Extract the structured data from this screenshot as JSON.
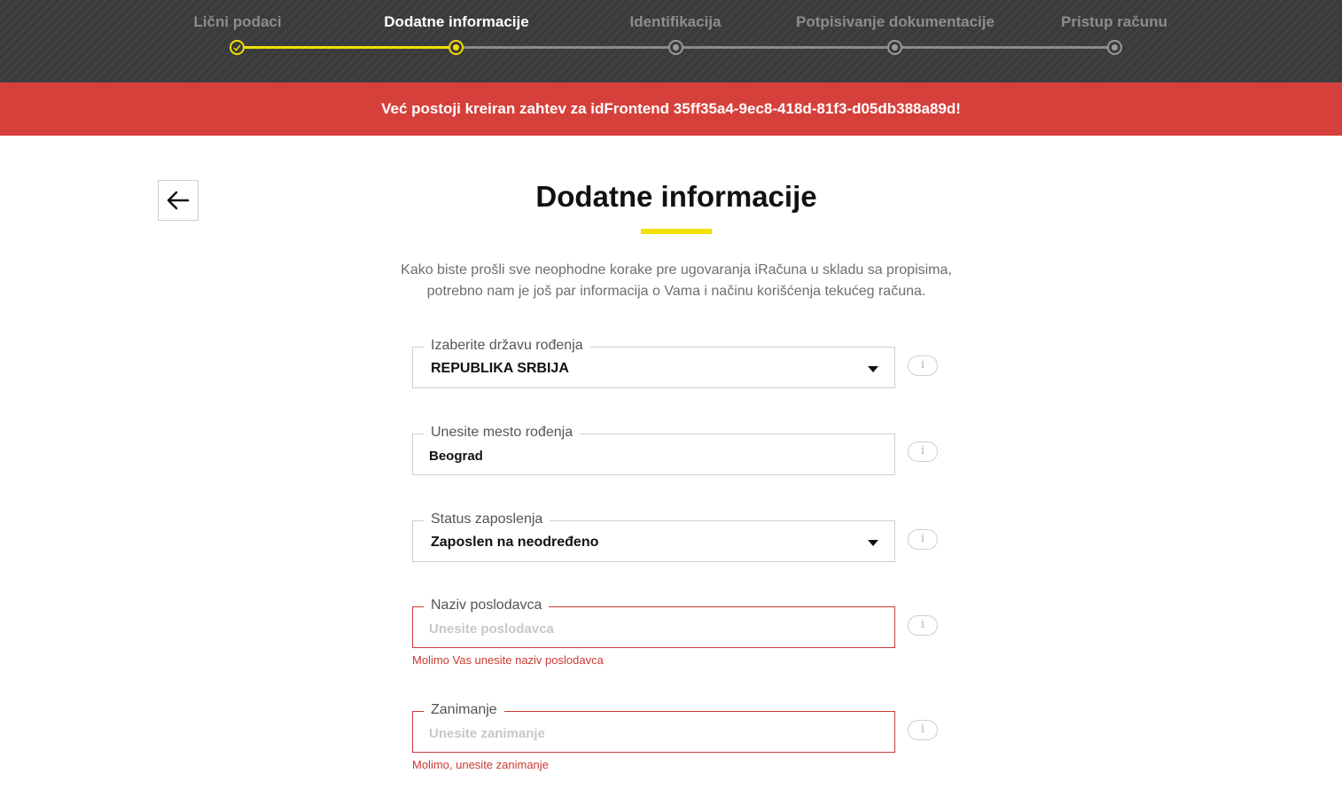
{
  "stepper": {
    "steps": [
      {
        "label": "Lični podaci",
        "state": "done"
      },
      {
        "label": "Dodatne informacije",
        "state": "active"
      },
      {
        "label": "Identifikacija",
        "state": "pending"
      },
      {
        "label": "Potpisivanje dokumentacije",
        "state": "pending"
      },
      {
        "label": "Pristup računu",
        "state": "pending"
      }
    ]
  },
  "banner": {
    "message": "Već postoji kreiran zahtev za idFrontend 35ff35a4-9ec8-418d-81f3-d05db388a89d!"
  },
  "back_button": {
    "icon": "arrow-left-icon"
  },
  "page": {
    "title": "Dodatne informacije",
    "intro_line1": "Kako biste prošli sve neophodne korake pre ugovaranja iRačuna u skladu sa propisima,",
    "intro_line2": "potrebno nam je još par informacija o Vama i načinu korišćenja tekućeg računa."
  },
  "form": {
    "country": {
      "label": "Izaberite državu rođenja",
      "value": "REPUBLIKA SRBIJA"
    },
    "birthplace": {
      "label": "Unesite mesto rođenja",
      "value": "Beograd"
    },
    "employment": {
      "label": "Status zaposlenja",
      "value": "Zaposlen na neodređeno"
    },
    "employer": {
      "label": "Naziv poslodavca",
      "placeholder": "Unesite poslodavca",
      "error": "Molimo Vas unesite naziv poslodavca"
    },
    "occupation": {
      "label": "Zanimanje",
      "placeholder": "Unesite zanimanje",
      "error": "Molimo, unesite zanimanje"
    },
    "info_glyph": "i"
  },
  "colors": {
    "accent": "#f2e000",
    "error": "#d6403b",
    "header_bg": "#3a3b3d"
  }
}
